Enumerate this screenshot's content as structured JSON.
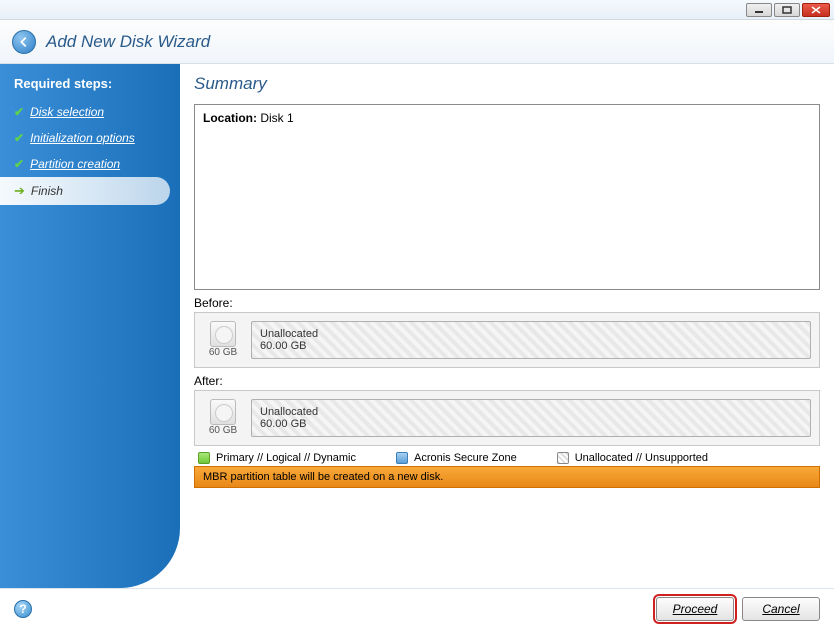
{
  "window": {
    "title": "Add New Disk Wizard"
  },
  "sidebar": {
    "header": "Required steps:",
    "steps": [
      {
        "label": "Disk selection",
        "done": true
      },
      {
        "label": "Initialization options",
        "done": true
      },
      {
        "label": "Partition creation",
        "done": true
      },
      {
        "label": "Finish",
        "active": true
      }
    ]
  },
  "main": {
    "title": "Summary",
    "location_label": "Location:",
    "location_value": "Disk 1",
    "before_label": "Before:",
    "after_label": "After:",
    "disk_size": "60 GB",
    "partition_name": "Unallocated",
    "partition_size": "60.00 GB",
    "legend": {
      "primary": "Primary // Logical // Dynamic",
      "acronis": "Acronis Secure Zone",
      "unalloc": "Unallocated // Unsupported"
    },
    "status": "MBR partition table will be created on a new disk."
  },
  "footer": {
    "proceed": "Proceed",
    "cancel": "Cancel"
  }
}
